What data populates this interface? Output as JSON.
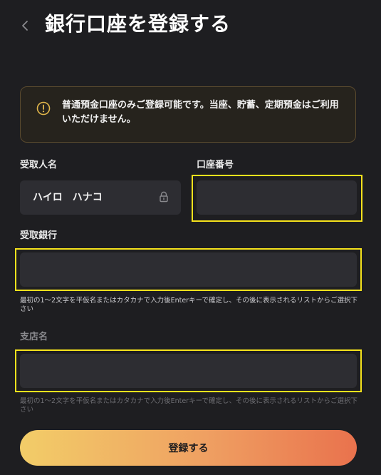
{
  "header": {
    "back_glyph": "‹",
    "title": "銀行口座を登録する"
  },
  "notice": {
    "icon": "warning-circle-icon",
    "text": "普通預金口座のみご登録可能です。当座、貯蓄、定期預金はご利用いただけません。"
  },
  "form": {
    "recipient_name": {
      "label": "受取人名",
      "value": "ハイロ　ハナコ",
      "icon": "lock-icon"
    },
    "account_number": {
      "label": "口座番号",
      "value": "",
      "placeholder": ""
    },
    "bank": {
      "label": "受取銀行",
      "value": "",
      "placeholder": "",
      "hint": "最初の1〜2文字を平仮名またはカタカナで入力後Enterキーで確定し、その後に表示されるリストからご選択下さい"
    },
    "branch": {
      "label": "支店名",
      "value": "",
      "placeholder": "",
      "hint": "最初の1〜2文字を平仮名またはカタカナで入力後Enterキーで確定し、その後に表示されるリストからご選択下さい"
    },
    "submit_label": "登録する"
  },
  "colors": {
    "background": "#1e1e21",
    "field": "#2d2d32",
    "highlight": "#f5e21c",
    "notice_border": "#5a4a2e",
    "button_gradient_start": "#f2cd68",
    "button_gradient_end": "#e9724d"
  }
}
